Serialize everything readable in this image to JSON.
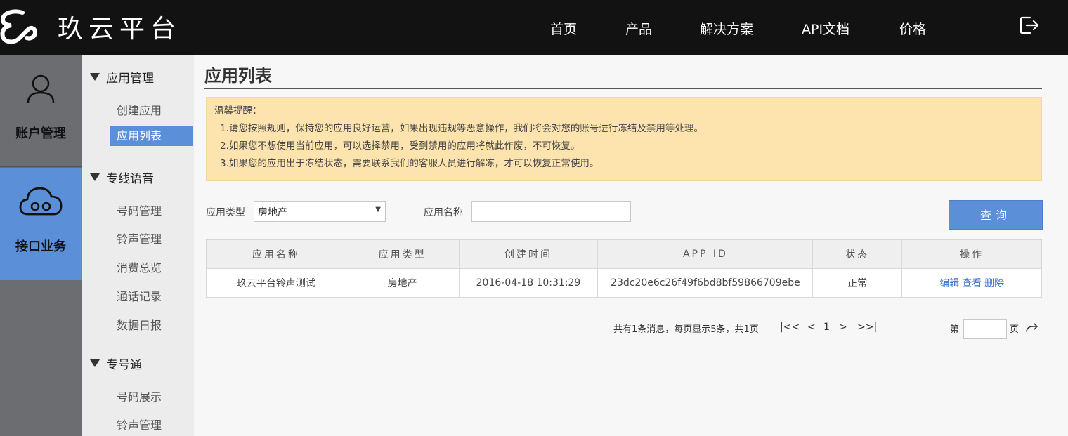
{
  "header": {
    "brand": "玖云平台",
    "nav": [
      "首页",
      "产品",
      "解决方案",
      "API文档",
      "价格"
    ]
  },
  "rail": {
    "items": [
      {
        "label": "账户管理",
        "icon": "user-icon"
      },
      {
        "label": "接口业务",
        "icon": "cloud-icon"
      }
    ]
  },
  "submenu": {
    "groups": [
      {
        "title": "应用管理",
        "items": [
          "创建应用",
          "应用列表"
        ]
      },
      {
        "title": "专线语音",
        "items": [
          "号码管理",
          "铃声管理",
          "消费总览",
          "通话记录",
          "数据日报"
        ]
      },
      {
        "title": "专号通",
        "items": [
          "号码展示",
          "铃声管理"
        ]
      }
    ],
    "active": "应用列表"
  },
  "main": {
    "title": "应用列表",
    "notice": {
      "heading": "温馨提醒：",
      "lines": [
        "1.请您按照规则，保持您的应用良好运营，如果出现违规等恶意操作，我们将会对您的账号进行冻结及禁用等处理。",
        "2.如果您不想使用当前应用，可以选择禁用，受到禁用的应用将就此作废，不可恢复。",
        "3.如果您的应用出于冻结状态，需要联系我们的客服人员进行解冻，才可以恢复正常使用。"
      ]
    },
    "filter": {
      "type_label": "应用类型",
      "type_value": "房地产",
      "name_label": "应用名称",
      "name_value": "",
      "query_button": "查询"
    },
    "table": {
      "headers": [
        "应用名称",
        "应用类型",
        "创建时间",
        "APP ID",
        "状态",
        "操作"
      ],
      "rows": [
        {
          "name": "玖云平台铃声测试",
          "type": "房地产",
          "created": "2016-04-18 10:31:29",
          "app_id": "23dc20e6c26f49f6bd8bf59866709ebe",
          "status": "正常",
          "actions": [
            "编辑",
            "查看",
            "删除"
          ]
        }
      ]
    },
    "pagination": {
      "summary": "共有1条消息，每页显示5条，共1页",
      "first": "|<<",
      "prev": "<",
      "current": "1",
      "next": ">",
      "last": ">>|",
      "goto_prefix": "第",
      "goto_suffix": "页",
      "goto_value": ""
    }
  },
  "colors": {
    "topbar": "#121212",
    "accent": "#5b8fd8",
    "rail": "#6b6d70",
    "notice_bg": "#fde4ae",
    "link": "#3d6fd0"
  }
}
